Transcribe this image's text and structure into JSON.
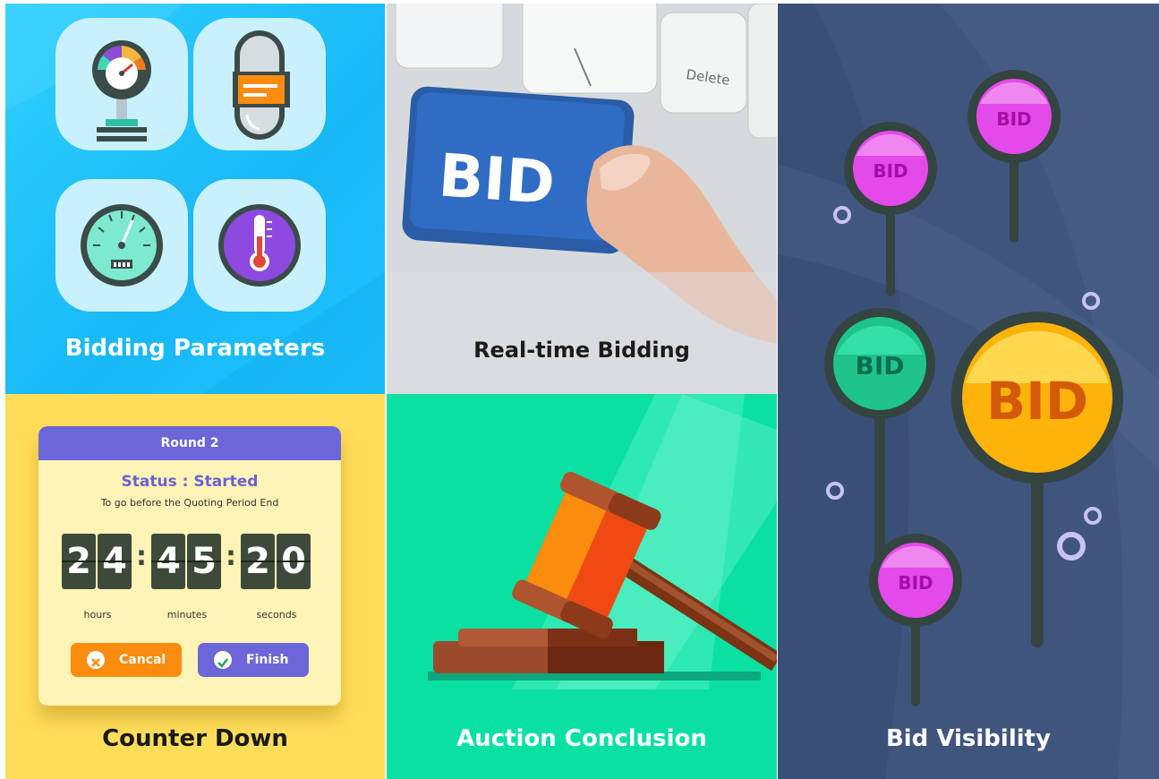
{
  "tiles": {
    "params": {
      "title": "Bidding Parameters"
    },
    "realtime": {
      "title": "Real-time Bidding",
      "key_label": "BID",
      "delete_key": "Delete"
    },
    "counter": {
      "title": "Counter Down",
      "round": "Round 2",
      "status": "Status : Started",
      "subtitle": "To go before the Quoting Period End",
      "hours": [
        "2",
        "4"
      ],
      "minutes": [
        "4",
        "5"
      ],
      "seconds": [
        "2",
        "0"
      ],
      "separator": ":",
      "units": {
        "hours": "hours",
        "minutes": "minutes",
        "seconds": "seconds"
      },
      "cancel_label": "Cancal",
      "finish_label": "Finish"
    },
    "conclusion": {
      "title": "Auction Conclusion"
    },
    "visibility": {
      "title": "Bid Visibility",
      "pin_label": "BID"
    }
  },
  "colors": {
    "sky": "#18b8f6",
    "yellow": "#fedd59",
    "mint": "#0be0a3",
    "navy": "#3f557e",
    "purple": "#6d66d8",
    "orange": "#fb8c0e"
  },
  "icons": [
    "pressure-gauge-icon",
    "capsule-icon",
    "speedometer-icon",
    "thermometer-icon",
    "gavel-icon",
    "close-icon",
    "check-icon",
    "bid-pin-icon"
  ]
}
